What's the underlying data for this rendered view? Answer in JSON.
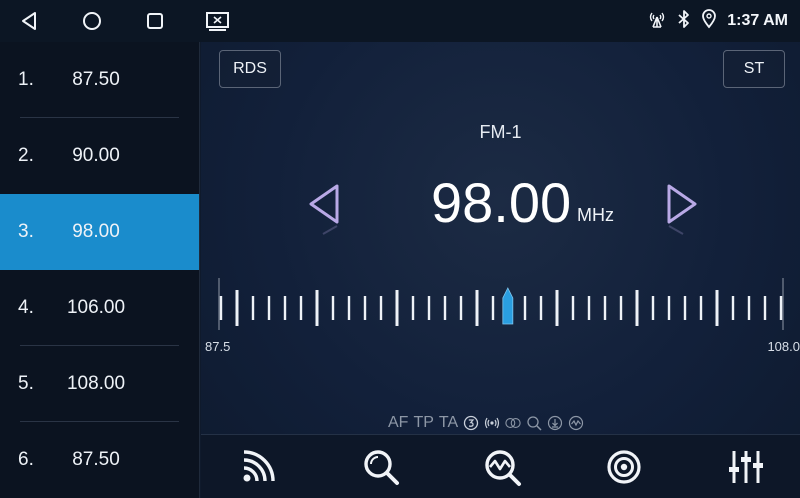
{
  "status": {
    "time": "1:37 AM",
    "icons": [
      "back-icon",
      "home-icon",
      "recents-icon",
      "screen-cast-icon",
      "signal-tower-icon",
      "bluetooth-icon",
      "location-icon"
    ]
  },
  "presets": [
    {
      "num": "1.",
      "freq": "87.50",
      "selected": false
    },
    {
      "num": "2.",
      "freq": "90.00",
      "selected": false
    },
    {
      "num": "3.",
      "freq": "98.00",
      "selected": true
    },
    {
      "num": "4.",
      "freq": "106.00",
      "selected": false
    },
    {
      "num": "5.",
      "freq": "108.00",
      "selected": false
    },
    {
      "num": "6.",
      "freq": "87.50",
      "selected": false
    }
  ],
  "main": {
    "rds_label": "RDS",
    "st_label": "ST",
    "band": "FM-1",
    "frequency": "98.00",
    "unit": "MHz",
    "scale_min_label": "87.5",
    "scale_max_label": "108.0",
    "scale_min": 87.5,
    "scale_max": 108.0,
    "current": 98.0,
    "rds_flags": [
      "AF",
      "TP",
      "TA"
    ],
    "rds_icons": [
      "stereo-3-icon",
      "broadcast-icon",
      "loop-icon",
      "search-icon",
      "download-icon",
      "wave-icon"
    ]
  },
  "toolbar": [
    "signal-icon",
    "search-icon",
    "scan-icon",
    "radio-icon",
    "equalizer-icon"
  ],
  "colors": {
    "accent": "#1a8ccc",
    "background": "#0f1a2c",
    "arrow": "#b9a9e6"
  }
}
